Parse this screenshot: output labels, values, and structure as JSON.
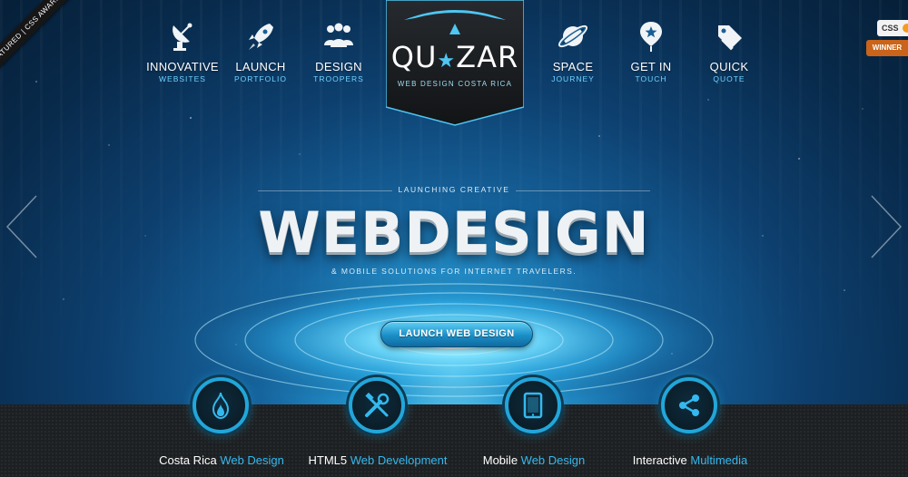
{
  "ribbon": {
    "text": "FEATURED | CSS AWARDS"
  },
  "badges": {
    "css": "CSS",
    "winner": "WINNER"
  },
  "nav_left": [
    {
      "main": "INNOVATIVE",
      "sub": "WEBSITES",
      "icon": "satellite-dish-icon"
    },
    {
      "main": "LAUNCH",
      "sub": "PORTFOLIO",
      "icon": "rocket-icon"
    },
    {
      "main": "DESIGN",
      "sub": "TROOPERS",
      "icon": "team-icon"
    }
  ],
  "nav_right": [
    {
      "main": "SPACE",
      "sub": "JOURNEY",
      "icon": "planet-icon"
    },
    {
      "main": "GET IN",
      "sub": "TOUCH",
      "icon": "map-pin-star-icon"
    },
    {
      "main": "QUICK",
      "sub": "QUOTE",
      "icon": "price-tag-icon"
    }
  ],
  "logo": {
    "left": "QU",
    "right": "ZAR",
    "subtitle": "WEB DESIGN COSTA RICA"
  },
  "hero": {
    "kicker": "LAUNCHING CREATIVE",
    "headline": "WEBDESIGN",
    "tagline": "& MOBILE SOLUTIONS FOR INTERNET TRAVELERS.",
    "cta": "LAUNCH WEB DESIGN"
  },
  "services": [
    {
      "prefix": "Costa Rica",
      "accent": "Web Design",
      "icon": "flame-icon"
    },
    {
      "prefix": "HTML5",
      "accent": "Web Development",
      "icon": "tools-icon"
    },
    {
      "prefix": "Mobile",
      "accent": "Web Design",
      "icon": "tablet-icon"
    },
    {
      "prefix": "Interactive",
      "accent": "Multimedia",
      "icon": "share-icon"
    }
  ],
  "colors": {
    "accent": "#33b9f0",
    "cta_top": "#5fd0f5",
    "cta_bottom": "#106aa0",
    "band": "#1d2022"
  }
}
